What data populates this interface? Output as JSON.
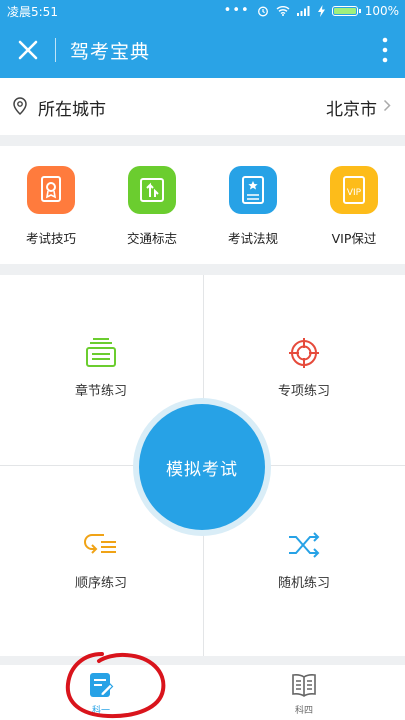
{
  "status": {
    "time": "凌晨5:51",
    "battery": "100%"
  },
  "header": {
    "title": "驾考宝典"
  },
  "city": {
    "label": "所在城市",
    "value": "北京市"
  },
  "shortcuts": [
    {
      "label": "考试技巧",
      "color": "#ff7b3d",
      "icon": "certificate-icon"
    },
    {
      "label": "交通标志",
      "color": "#6bcd2f",
      "icon": "traffic-sign-icon"
    },
    {
      "label": "考试法规",
      "color": "#27a2e6",
      "icon": "book-star-icon"
    },
    {
      "label": "VIP保过",
      "color": "#fdbc1a",
      "icon": "vip-book-icon",
      "badge": "VIP"
    }
  ],
  "practice": {
    "chapter": "章节练习",
    "special": "专项练习",
    "sequential": "顺序练习",
    "random": "随机练习",
    "exam": "模拟考试"
  },
  "tabs": [
    {
      "label": "科一",
      "active": true
    },
    {
      "label": "科四",
      "active": false
    }
  ],
  "colors": {
    "primary": "#2aa3e6",
    "annotation": "#d9141c"
  }
}
